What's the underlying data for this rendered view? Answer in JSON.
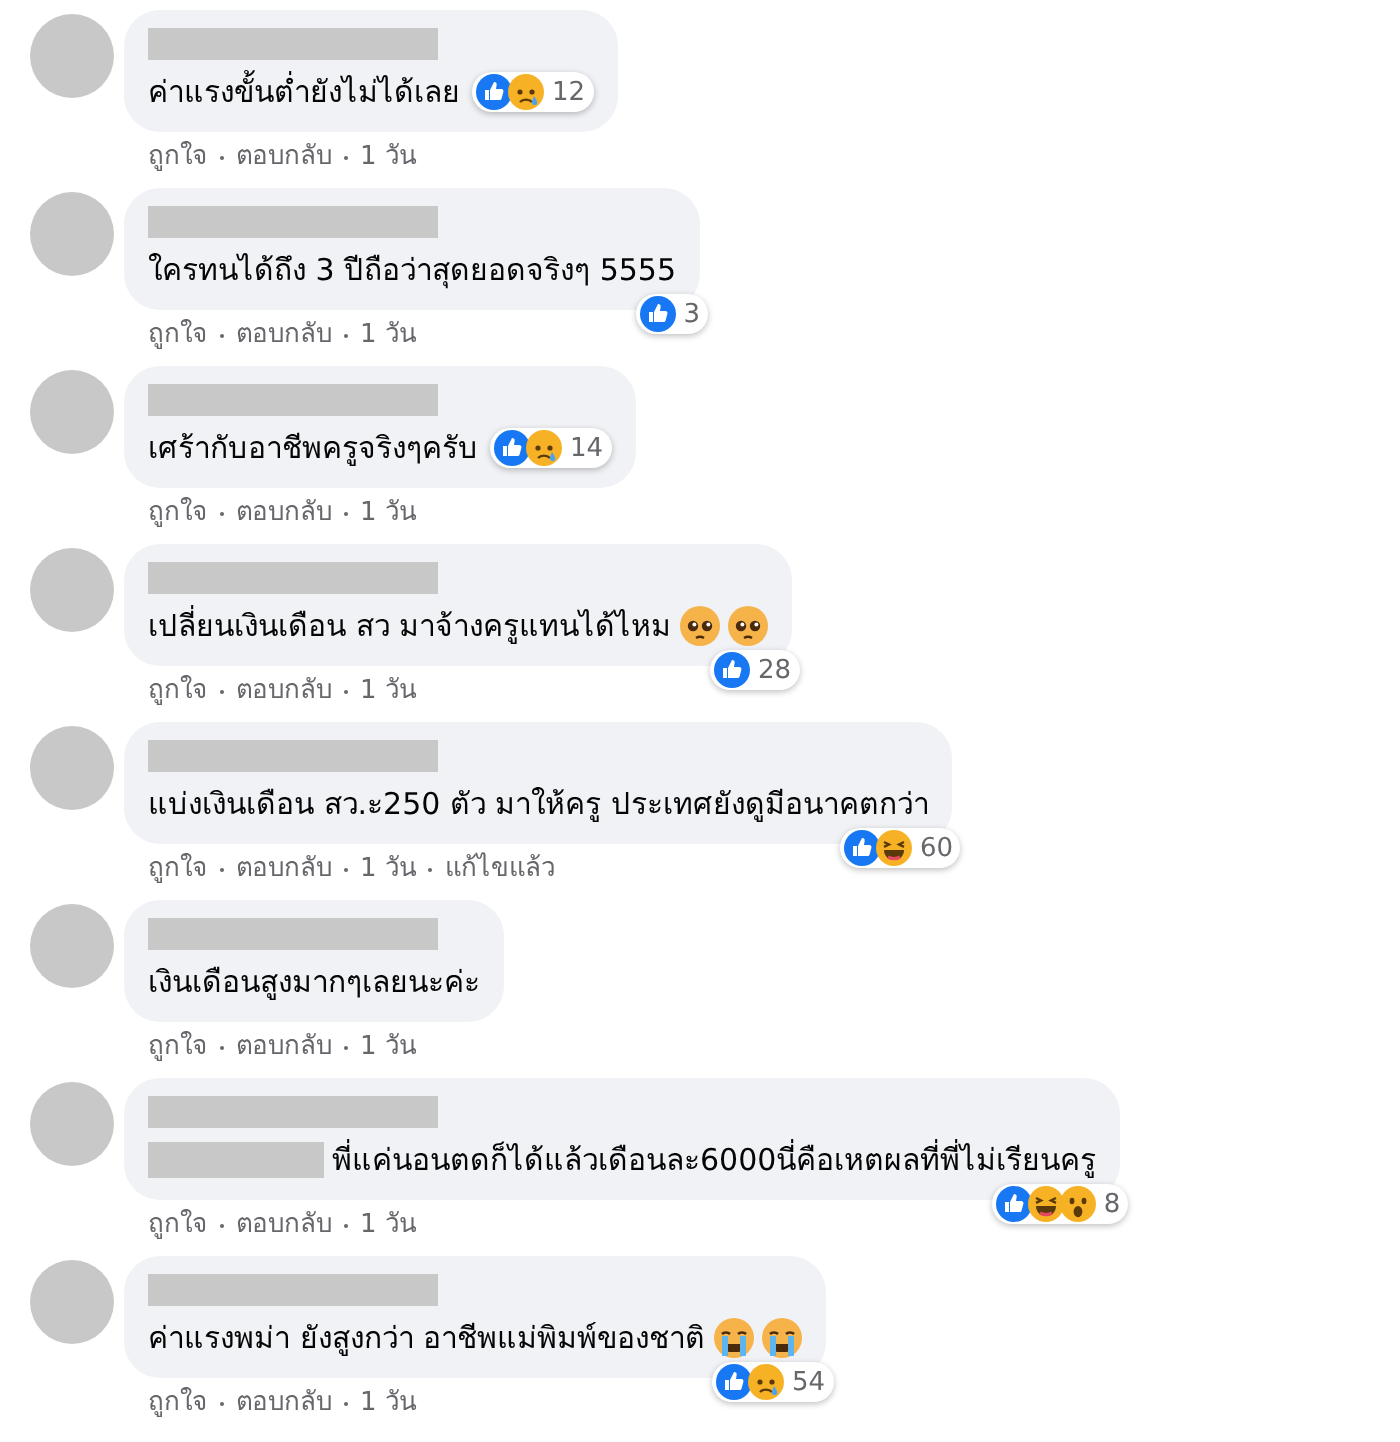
{
  "comments": [
    {
      "text": "ค่าแรงขั้นต่ำยังไม่ได้เลย",
      "reactions": {
        "below": false,
        "icons": [
          {
            "kind": "like"
          },
          {
            "kind": "sad"
          }
        ],
        "count": "12"
      },
      "actions": [
        "ถูกใจ",
        "ตอบกลับ",
        "1 วัน"
      ]
    },
    {
      "text": "ใครทนได้ถึง 3 ปีถือว่าสุดยอดจริงๆ 5555",
      "reactions": {
        "below": true,
        "icons": [
          {
            "kind": "like"
          }
        ],
        "count": "3"
      },
      "actions": [
        "ถูกใจ",
        "ตอบกลับ",
        "1 วัน"
      ]
    },
    {
      "text": "เศร้ากับอาชีพครูจริงๆครับ",
      "reactions": {
        "below": false,
        "icons": [
          {
            "kind": "like"
          },
          {
            "kind": "sad"
          }
        ],
        "count": "14"
      },
      "actions": [
        "ถูกใจ",
        "ตอบกลับ",
        "1 วัน"
      ]
    },
    {
      "text": "เปลี่ยนเงินเดือน สว มาจ้างครูแทนได้ไหม",
      "emoji": [
        {
          "kind": "pleading"
        },
        {
          "kind": "pleading"
        }
      ],
      "reactions": {
        "below": true,
        "icons": [
          {
            "kind": "like"
          }
        ],
        "count": "28"
      },
      "actions": [
        "ถูกใจ",
        "ตอบกลับ",
        "1 วัน"
      ]
    },
    {
      "text": "แบ่งเงินเดือน สว.ะ250 ตัว มาให้ครู ประเทศยังดูมีอนาคตกว่า",
      "reactions": {
        "below": true,
        "icons": [
          {
            "kind": "like"
          },
          {
            "kind": "haha"
          }
        ],
        "count": "60"
      },
      "actions": [
        "ถูกใจ",
        "ตอบกลับ",
        "1 วัน",
        "แก้ไขแล้ว"
      ]
    },
    {
      "text": "เงินเดือนสูงมากๆเลยนะค่ะ",
      "actions": [
        "ถูกใจ",
        "ตอบกลับ",
        "1 วัน"
      ]
    },
    {
      "text": "พี่แค่นอนตดก็ได้แล้วเดือนละ6000นี่คือเหตผลที่พี่ไม่เรียนครู",
      "tagged": true,
      "reactions": {
        "below": true,
        "icons": [
          {
            "kind": "like"
          },
          {
            "kind": "haha"
          },
          {
            "kind": "wow"
          }
        ],
        "count": "8"
      },
      "actions": [
        "ถูกใจ",
        "ตอบกลับ",
        "1 วัน"
      ]
    },
    {
      "text": "ค่าแรงพม่า ยังสูงกว่า อาชีพแม่พิมพ์ของชาติ",
      "emoji": [
        {
          "kind": "crying"
        },
        {
          "kind": "crying"
        }
      ],
      "reactions": {
        "below": true,
        "icons": [
          {
            "kind": "like"
          },
          {
            "kind": "sad"
          }
        ],
        "count": "54"
      },
      "actions": [
        "ถูกใจ",
        "ตอบกลับ",
        "1 วัน"
      ]
    }
  ]
}
